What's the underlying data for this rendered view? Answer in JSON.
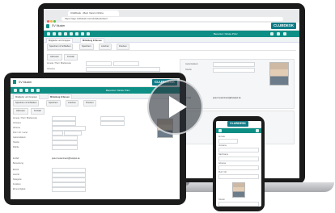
{
  "laptop": {
    "browser_tab": "ClubDesk - Mein Verein Online",
    "address": "https://app.clubdesk.com/clubdesk/start",
    "app_title": "SV Muster",
    "logo": "CLUBDESK",
    "user": "Benutzer: Nicole Prinz",
    "subtabs": [
      "Mitglieder und Gruppen",
      "Mitteilung Erfassen"
    ],
    "toolbar": [
      "Speichern & Schließen",
      "Speichern",
      "Löschen",
      "Drucken"
    ],
    "form_tabs": [
      "Adressen",
      "Kontakt"
    ],
    "labels": [
      "Anrede / Titel / Briefanrede",
      "Vorname",
      "Nachname",
      "Adresse",
      "PLZ / Ort / Land",
      "Geburtsdatum",
      "Telefon",
      "E-Mail"
    ],
    "email": "peter.mustermann@beispiel.de",
    "colors": {
      "accent": "#0e8f86",
      "logo": "#0f7b86"
    }
  },
  "tablet": {
    "app_title": "SV Muster",
    "logo": "CLUBDESK",
    "user": "Benutzer: Nicole Prinz",
    "subtabs": [
      "Mitglieder und Gruppen",
      "Mitteilung Erfassen"
    ],
    "toolbar": [
      "Speichern & Schließen",
      "Speichern",
      "Löschen",
      "Drucken"
    ],
    "form_tabs": [
      "Adressen",
      "Kontakt"
    ],
    "labels": [
      "Anrede / Titel / Briefanrede",
      "Vorname",
      "Nachname",
      "Adresse",
      "PLZ / Ort / Land",
      "Geburtsdatum",
      "Telefon",
      "Mobile",
      "E-Mail",
      "Bemerkung",
      "Eintritt",
      "Austritt",
      "Kategorie",
      "Funktion",
      "Ehrenmitglied"
    ],
    "email": "peter.mustermann@beispiel.de"
  },
  "phone": {
    "logo": "CLUBDESK",
    "labels": [
      "Anrede",
      "Vorname",
      "Nachname",
      "Adresse",
      "PLZ / Ort",
      "Telefon",
      "E-Mail"
    ]
  },
  "play_button": {
    "icon": "play-icon"
  }
}
